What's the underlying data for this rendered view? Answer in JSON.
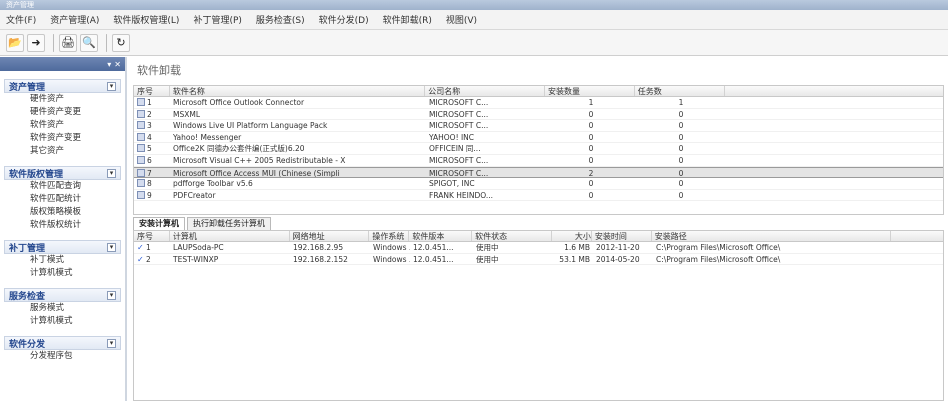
{
  "window": {
    "title": "资产管理"
  },
  "menu": [
    {
      "label": "文件(F)"
    },
    {
      "label": "资产管理(A)"
    },
    {
      "label": "软件版权管理(L)"
    },
    {
      "label": "补丁管理(P)"
    },
    {
      "label": "服务检查(S)"
    },
    {
      "label": "软件分发(D)"
    },
    {
      "label": "软件卸载(R)"
    },
    {
      "label": "视图(V)"
    }
  ],
  "toolbar": [
    {
      "icon": "open-folder-icon",
      "glyph": "📂"
    },
    {
      "icon": "import-icon",
      "glyph": "➜"
    },
    {
      "icon": "print-icon",
      "glyph": "🖨"
    },
    {
      "icon": "print-preview-icon",
      "glyph": "🔍"
    },
    {
      "icon": "refresh-icon",
      "glyph": "↻"
    }
  ],
  "sidebar": {
    "groups": [
      {
        "title": "资产管理",
        "toggle": "▾",
        "items": [
          "硬件资产",
          "硬件资产变更",
          "软件资产",
          "软件资产变更",
          "其它资产"
        ]
      },
      {
        "title": "软件版权管理",
        "toggle": "▾",
        "items": [
          "软件匹配查询",
          "软件匹配统计",
          "版权策略模板",
          "软件版权统计"
        ]
      },
      {
        "title": "补丁管理",
        "toggle": "▾",
        "items": [
          "补丁模式",
          "计算机模式"
        ]
      },
      {
        "title": "服务检查",
        "toggle": "▾",
        "items": [
          "服务模式",
          "计算机模式"
        ]
      },
      {
        "title": "软件分发",
        "toggle": "▾",
        "items": [
          "分发程序包"
        ]
      }
    ]
  },
  "main": {
    "title": "软件卸载",
    "software_table": {
      "columns": [
        "序号",
        "软件名称",
        "公司名称",
        "安装数量",
        "任务数"
      ],
      "rows": [
        [
          "1",
          "Microsoft Office Outlook Connector",
          "MICROSOFT C...",
          "1",
          "1"
        ],
        [
          "2",
          "MSXML",
          "MICROSOFT C...",
          "0",
          "0"
        ],
        [
          "3",
          "Windows Live UI Platform Language Pack",
          "MICROSOFT C...",
          "0",
          "0"
        ],
        [
          "4",
          "Yahoo! Messenger",
          "YAHOO! INC",
          "0",
          "0"
        ],
        [
          "5",
          "Office2K 同德办公套件编(正式版)6.20",
          "OFFICEIN 同...",
          "0",
          "0"
        ],
        [
          "6",
          "Microsoft Visual C++ 2005 Redistributable - X",
          "MICROSOFT C...",
          "0",
          "0"
        ],
        [
          "7",
          "Microsoft Office Access MUI (Chinese (Simpli",
          "MICROSOFT C...",
          "2",
          "0"
        ],
        [
          "8",
          "pdfforge Toolbar v5.6",
          "SPIGOT, INC",
          "0",
          "0"
        ],
        [
          "9",
          "PDFCreator",
          "FRANK HEINDO...",
          "0",
          "0"
        ]
      ],
      "selected_row": 6
    },
    "tabs": [
      {
        "label": "安装计算机",
        "active": true
      },
      {
        "label": "执行卸载任务计算机",
        "active": false
      }
    ],
    "computer_table": {
      "columns": [
        "序号",
        "计算机",
        "网络地址",
        "操作系统",
        "软件版本",
        "软件状态",
        "大小",
        "安装时间",
        "安装路径"
      ],
      "rows": [
        [
          "1",
          "LAUPSoda-PC",
          "192.168.2.95",
          "Windows ...",
          "12.0.451...",
          "使用中",
          "1.6 MB",
          "2012-11-20",
          "C:\\Program Files\\Microsoft Office\\"
        ],
        [
          "2",
          "TEST-WINXP",
          "192.168.2.152",
          "Windows ...",
          "12.0.451...",
          "使用中",
          "53.1 MB",
          "2014-05-20",
          "C:\\Program Files\\Microsoft Office\\"
        ]
      ]
    }
  }
}
